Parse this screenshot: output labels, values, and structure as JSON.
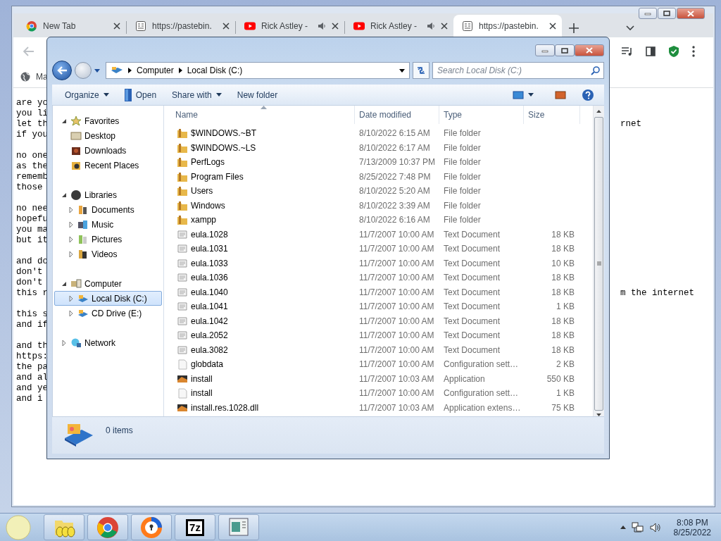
{
  "browser": {
    "tabs": [
      {
        "title": "New Tab",
        "kind": "newtab",
        "audio": false,
        "selected": false
      },
      {
        "title": "https://pastebin.",
        "kind": "paste",
        "audio": false,
        "selected": false
      },
      {
        "title": "Rick Astley -",
        "kind": "video",
        "audio": true,
        "selected": false
      },
      {
        "title": "Rick Astley -",
        "kind": "video",
        "audio": true,
        "selected": false
      },
      {
        "title": "https://pastebin.",
        "kind": "paste",
        "audio": false,
        "selected": true
      }
    ],
    "bookmark": {
      "label": "Ma"
    }
  },
  "paste": {
    "paragraphs": [
      [
        {
          "text": "are yo"
        },
        {
          "text": "you li"
        },
        {
          "text": "let th",
          "right": "rnet"
        },
        {
          "text": "if you"
        }
      ],
      [
        {
          "text": "no one"
        },
        {
          "text": "as the"
        },
        {
          "text": "rememb"
        },
        {
          "text": "those"
        }
      ],
      [
        {
          "text": "no nee"
        },
        {
          "text": "hopefu"
        },
        {
          "text": "you ma"
        },
        {
          "text": "but it"
        }
      ],
      [
        {
          "text": "and do"
        },
        {
          "text": "don't"
        },
        {
          "text": "don't"
        },
        {
          "text": "this r",
          "right": "m the internet"
        }
      ],
      [
        {
          "text": "this s"
        },
        {
          "text": "and if"
        }
      ],
      [
        {
          "text": "and th"
        },
        {
          "text": "https:"
        },
        {
          "text": "the pa"
        },
        {
          "text": "and al"
        },
        {
          "text": "and ye"
        },
        {
          "text": "and i"
        }
      ]
    ]
  },
  "explorer": {
    "breadcrumb": [
      "Computer",
      "Local Disk (C:)"
    ],
    "search": {
      "placeholder": "Search Local Disk (C:)"
    },
    "toolbar": [
      {
        "label": "Organize",
        "kind": "menu"
      },
      {
        "label": "Open",
        "kind": "open"
      },
      {
        "label": "Share with",
        "kind": "menu"
      },
      {
        "label": "New folder",
        "kind": "plain"
      }
    ],
    "nav": [
      {
        "label": "Favorites",
        "kind": "star",
        "expanded": true,
        "selected": false,
        "children": [
          {
            "label": "Desktop",
            "kind": "desktop",
            "selected": false
          },
          {
            "label": "Downloads",
            "kind": "downloads",
            "selected": false
          },
          {
            "label": "Recent Places",
            "kind": "recent",
            "selected": false
          }
        ]
      },
      {
        "label": "Libraries",
        "kind": "library",
        "expanded": true,
        "selected": false,
        "children": [
          {
            "label": "Documents",
            "kind": "documents",
            "expanded": false,
            "selected": false
          },
          {
            "label": "Music",
            "kind": "music",
            "expanded": false,
            "selected": false
          },
          {
            "label": "Pictures",
            "kind": "pictures",
            "expanded": false,
            "selected": false
          },
          {
            "label": "Videos",
            "kind": "videos",
            "expanded": false,
            "selected": false
          }
        ]
      },
      {
        "label": "Computer",
        "kind": "computer",
        "expanded": true,
        "selected": false,
        "children": [
          {
            "label": "Local Disk (C:)",
            "kind": "disk",
            "expanded": false,
            "selected": true
          },
          {
            "label": "CD Drive (E:)",
            "kind": "disk",
            "expanded": false,
            "selected": false
          }
        ]
      },
      {
        "label": "Network",
        "kind": "network",
        "expanded": false,
        "selected": false
      }
    ],
    "columns": [
      "Name",
      "Date modified",
      "Type",
      "Size"
    ],
    "files": [
      {
        "name": "$WINDOWS.~BT",
        "date": "8/10/2022 6:15 AM",
        "type": "File folder",
        "kind": "folder"
      },
      {
        "name": "$WINDOWS.~LS",
        "date": "8/10/2022 6:17 AM",
        "type": "File folder",
        "kind": "folder"
      },
      {
        "name": "PerfLogs",
        "date": "7/13/2009 10:37 PM",
        "type": "File folder",
        "kind": "folder"
      },
      {
        "name": "Program Files",
        "date": "8/25/2022 7:48 PM",
        "type": "File folder",
        "kind": "folder"
      },
      {
        "name": "Users",
        "date": "8/10/2022 5:20 AM",
        "type": "File folder",
        "kind": "folder"
      },
      {
        "name": "Windows",
        "date": "8/10/2022 3:39 AM",
        "type": "File folder",
        "kind": "folder"
      },
      {
        "name": "xampp",
        "date": "8/10/2022 6:16 AM",
        "type": "File folder",
        "kind": "folder"
      },
      {
        "name": "eula.1028",
        "date": "11/7/2007 10:00 AM",
        "type": "Text Document",
        "size": "18 KB",
        "kind": "text"
      },
      {
        "name": "eula.1031",
        "date": "11/7/2007 10:00 AM",
        "type": "Text Document",
        "size": "18 KB",
        "kind": "text"
      },
      {
        "name": "eula.1033",
        "date": "11/7/2007 10:00 AM",
        "type": "Text Document",
        "size": "10 KB",
        "kind": "text"
      },
      {
        "name": "eula.1036",
        "date": "11/7/2007 10:00 AM",
        "type": "Text Document",
        "size": "18 KB",
        "kind": "text"
      },
      {
        "name": "eula.1040",
        "date": "11/7/2007 10:00 AM",
        "type": "Text Document",
        "size": "18 KB",
        "kind": "text"
      },
      {
        "name": "eula.1041",
        "date": "11/7/2007 10:00 AM",
        "type": "Text Document",
        "size": "1 KB",
        "kind": "text"
      },
      {
        "name": "eula.1042",
        "date": "11/7/2007 10:00 AM",
        "type": "Text Document",
        "size": "18 KB",
        "kind": "text"
      },
      {
        "name": "eula.2052",
        "date": "11/7/2007 10:00 AM",
        "type": "Text Document",
        "size": "18 KB",
        "kind": "text"
      },
      {
        "name": "eula.3082",
        "date": "11/7/2007 10:00 AM",
        "type": "Text Document",
        "size": "18 KB",
        "kind": "text"
      },
      {
        "name": "globdata",
        "date": "11/7/2007 10:00 AM",
        "type": "Configuration sett…",
        "size": "2 KB",
        "kind": "config"
      },
      {
        "name": "install",
        "date": "11/7/2007 10:03 AM",
        "type": "Application",
        "size": "550 KB",
        "kind": "app"
      },
      {
        "name": "install",
        "date": "11/7/2007 10:00 AM",
        "type": "Configuration sett…",
        "size": "1 KB",
        "kind": "config"
      },
      {
        "name": "install.res.1028.dll",
        "date": "11/7/2007 10:03 AM",
        "type": "Application extens…",
        "size": "75 KB",
        "kind": "app"
      }
    ],
    "details": {
      "status": "0 items"
    }
  },
  "taskbar": {
    "buttons": [
      {
        "kind": "folder"
      },
      {
        "kind": "chrome"
      },
      {
        "kind": "secure"
      },
      {
        "kind": "archiver",
        "label": "7z"
      },
      {
        "kind": "window"
      }
    ],
    "clock": {
      "time": "8:08 PM",
      "date": "8/25/2022"
    }
  }
}
